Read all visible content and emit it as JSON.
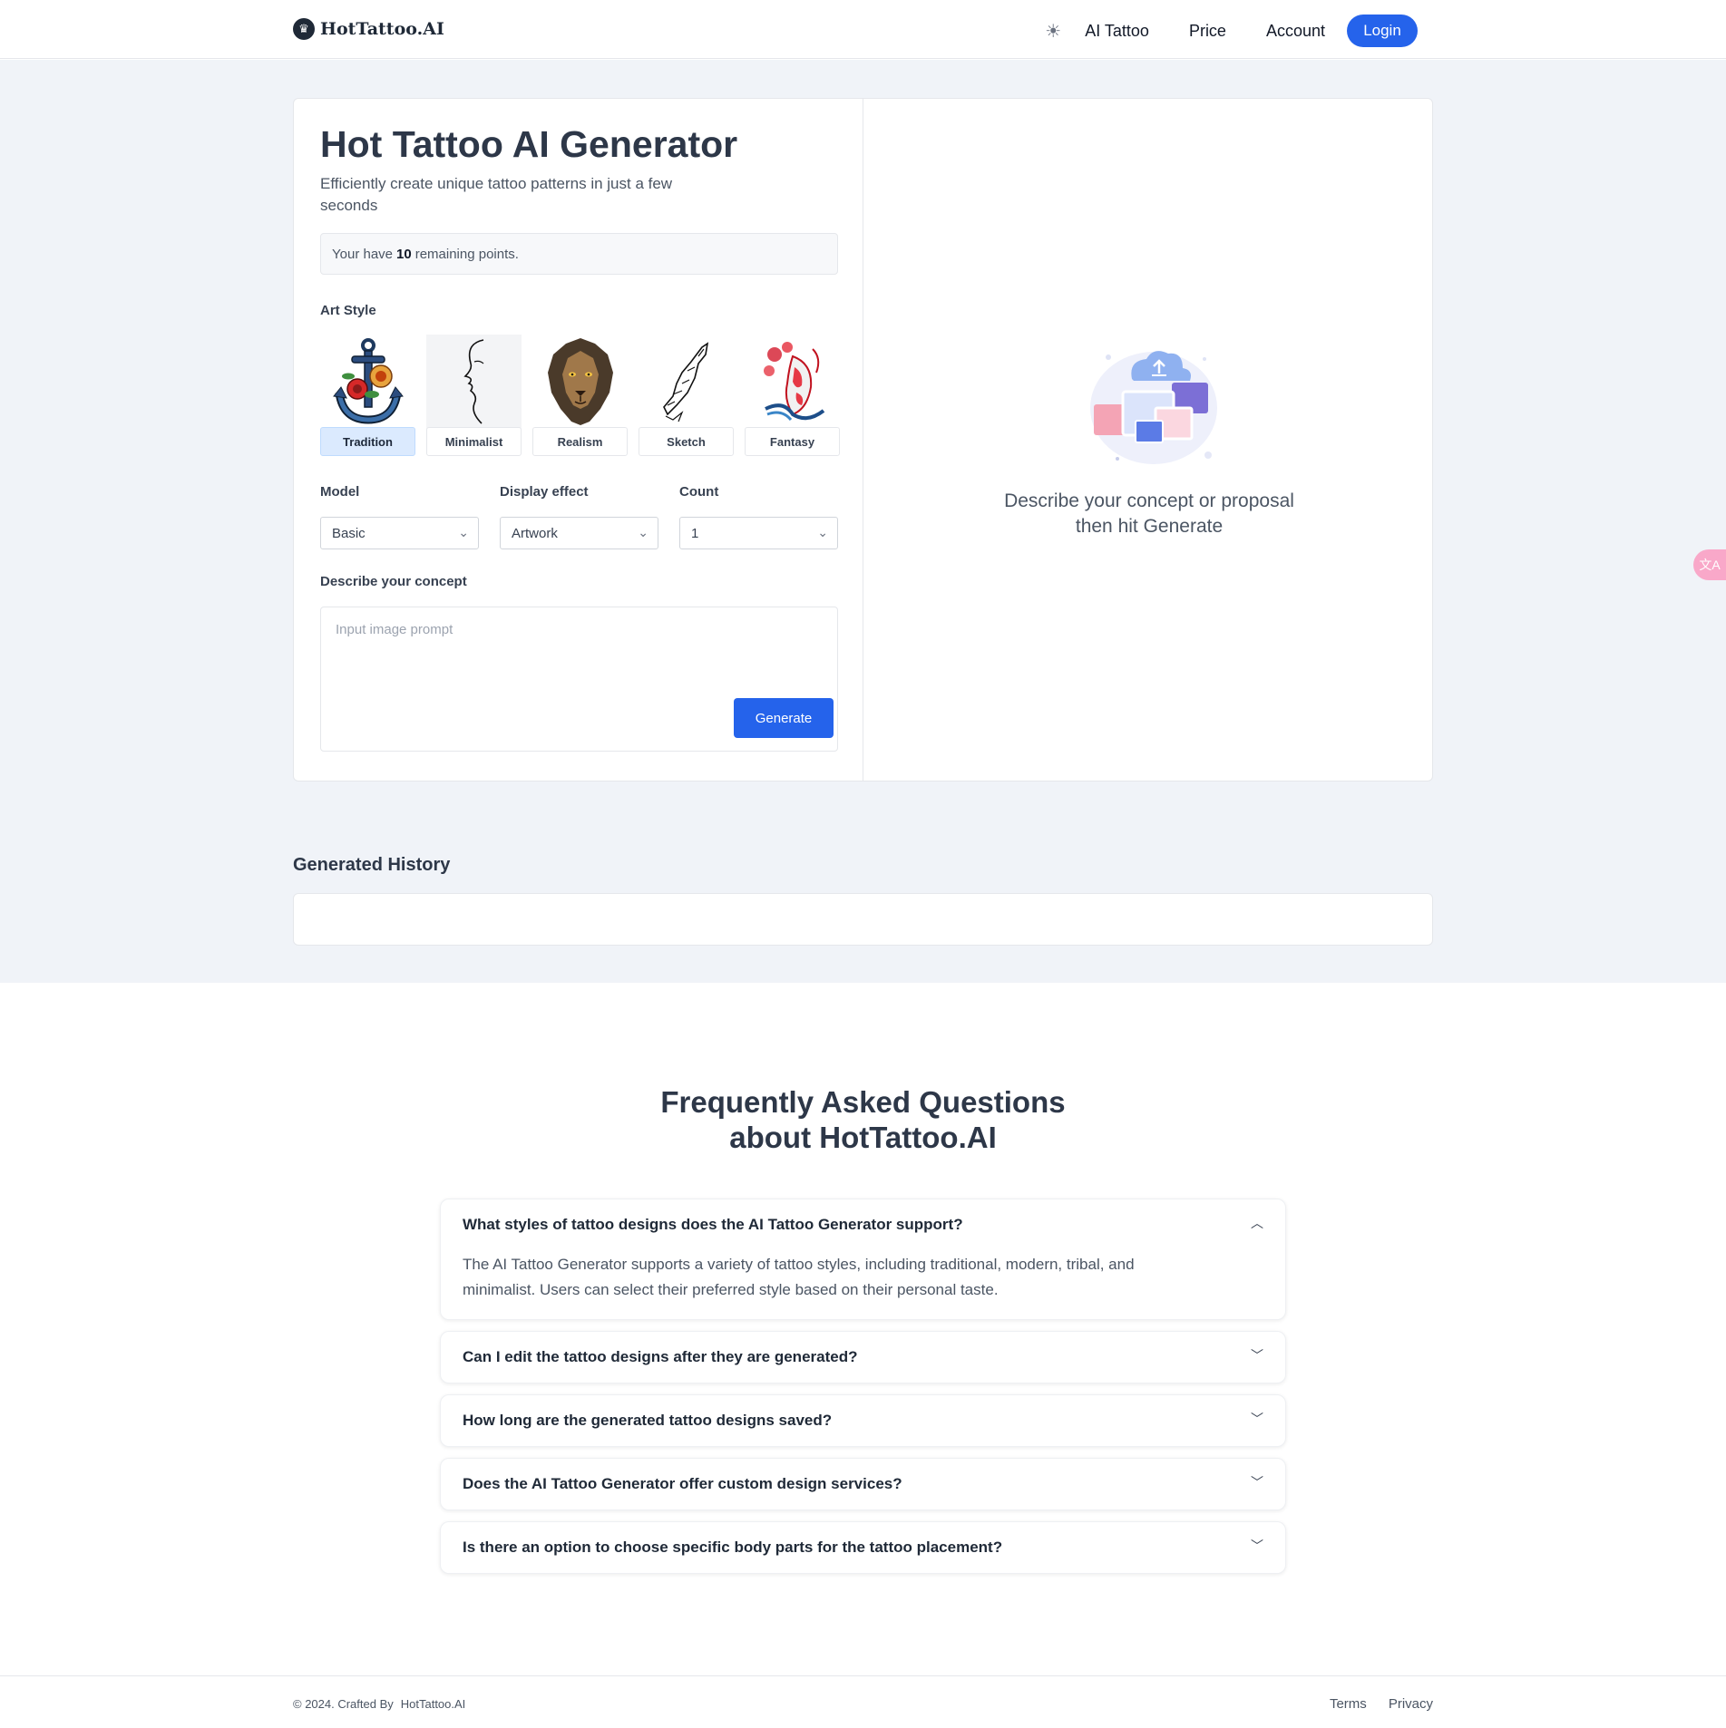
{
  "header": {
    "logo_text": "HotTattoo.AI",
    "nav": [
      "AI Tattoo",
      "Price",
      "Account"
    ],
    "login_label": "Login"
  },
  "generator": {
    "title": "Hot Tattoo AI Generator",
    "subtitle": "Efficiently create unique tattoo patterns in just a few seconds",
    "points_prefix": "Your have",
    "points_value": "10",
    "points_suffix": "remaining points.",
    "art_style_label": "Art Style",
    "styles": [
      {
        "label": "Tradition",
        "selected": true
      },
      {
        "label": "Minimalist",
        "selected": false
      },
      {
        "label": "Realism",
        "selected": false
      },
      {
        "label": "Sketch",
        "selected": false
      },
      {
        "label": "Fantasy",
        "selected": false
      }
    ],
    "model_label": "Model",
    "model_value": "Basic",
    "display_label": "Display effect",
    "display_value": "Artwork",
    "count_label": "Count",
    "count_value": "1",
    "concept_label": "Describe your concept",
    "prompt_placeholder": "Input image prompt",
    "generate_label": "Generate",
    "empty_text": "Describe your concept or proposal then hit Generate"
  },
  "history": {
    "title": "Generated History"
  },
  "faq": {
    "title_line1": "Frequently Asked Questions",
    "title_line2": "about HotTattoo.AI",
    "items": [
      {
        "q": "What styles of tattoo designs does the AI Tattoo Generator support?",
        "a": "The AI Tattoo Generator supports a variety of tattoo styles, including traditional, modern, tribal, and minimalist. Users can select their preferred style based on their personal taste.",
        "expanded": true
      },
      {
        "q": "Can I edit the tattoo designs after they are generated?",
        "a": "",
        "expanded": false
      },
      {
        "q": "How long are the generated tattoo designs saved?",
        "a": "",
        "expanded": false
      },
      {
        "q": "Does the AI Tattoo Generator offer custom design services?",
        "a": "",
        "expanded": false
      },
      {
        "q": "Is there an option to choose specific body parts for the tattoo placement?",
        "a": "",
        "expanded": false
      }
    ]
  },
  "footer": {
    "copyright": "© 2024. Crafted By",
    "brand": "HotTattoo.AI",
    "links": [
      "Terms",
      "Privacy"
    ]
  },
  "colors": {
    "accent": "#2563eb",
    "band_bg": "#f0f3f8",
    "selected_style_bg": "#dbeafe"
  },
  "icons": [
    "logo-icon",
    "sun-icon",
    "chevron-down-icon",
    "chevron-up-icon",
    "translate-icon",
    "upload-cloud-illustration"
  ]
}
